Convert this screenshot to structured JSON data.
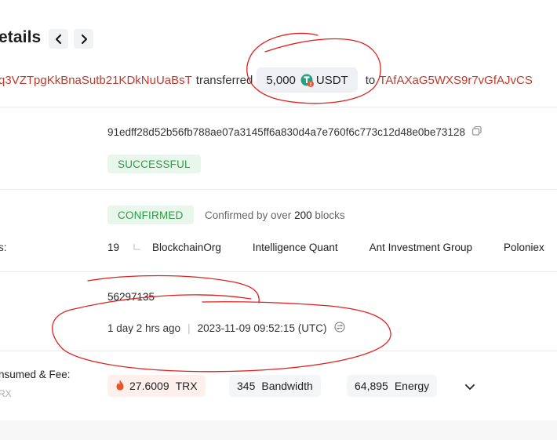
{
  "header": {
    "title": "etails",
    "prev_glyph": "‹",
    "next_glyph": "›"
  },
  "summary": {
    "from_address": "q3VZTpgKkBnaSutb21KDkNuUaBsT",
    "verb": "transferred",
    "amount": "5,000",
    "token": "USDT",
    "preposition": "to",
    "to_address": "TAfAXaG5WXS9r7vGfAJvCS"
  },
  "transaction": {
    "hash": "91edff28d52b56fb788ae07a3145ff6a830d4a7e760f6c773c12d48e0be73128",
    "result": "SUCCESSFUL"
  },
  "confirmation": {
    "status": "CONFIRMED",
    "text_prefix": "Confirmed by over",
    "block_count": "200",
    "text_suffix": "blocks",
    "voters_label": "s:",
    "voter_count": "19",
    "voters": [
      "BlockchainOrg",
      "Intelligence Quant",
      "Ant Investment Group",
      "Poloniex"
    ]
  },
  "block": {
    "number": "56297135",
    "age": "1 day 2 hrs ago",
    "separator": "|",
    "timestamp": "2023-11-09 09:52:15 (UTC)"
  },
  "resources": {
    "label": "nsumed & Fee:",
    "sublabel": "RX",
    "trx_amount": "27.6009",
    "trx_unit": "TRX",
    "bandwidth_amount": "345",
    "bandwidth_unit": "Bandwidth",
    "energy_amount": "64,895",
    "energy_unit": "Energy"
  },
  "colors": {
    "address": "#c0392b",
    "success_bg": "#e9f6ec",
    "success_text": "#2e9a46",
    "fee_bg": "#fdf0ec",
    "chip_bg": "#eef0f3",
    "annotation": "#e02020",
    "tether": "#26a17b"
  },
  "icons": {
    "prev": "chevron-left-icon",
    "next": "chevron-right-icon",
    "token": "tether-token-icon",
    "copy": "copy-icon",
    "clock": "clock-switch-icon",
    "flame": "flame-icon",
    "expand": "chevron-down-icon"
  }
}
